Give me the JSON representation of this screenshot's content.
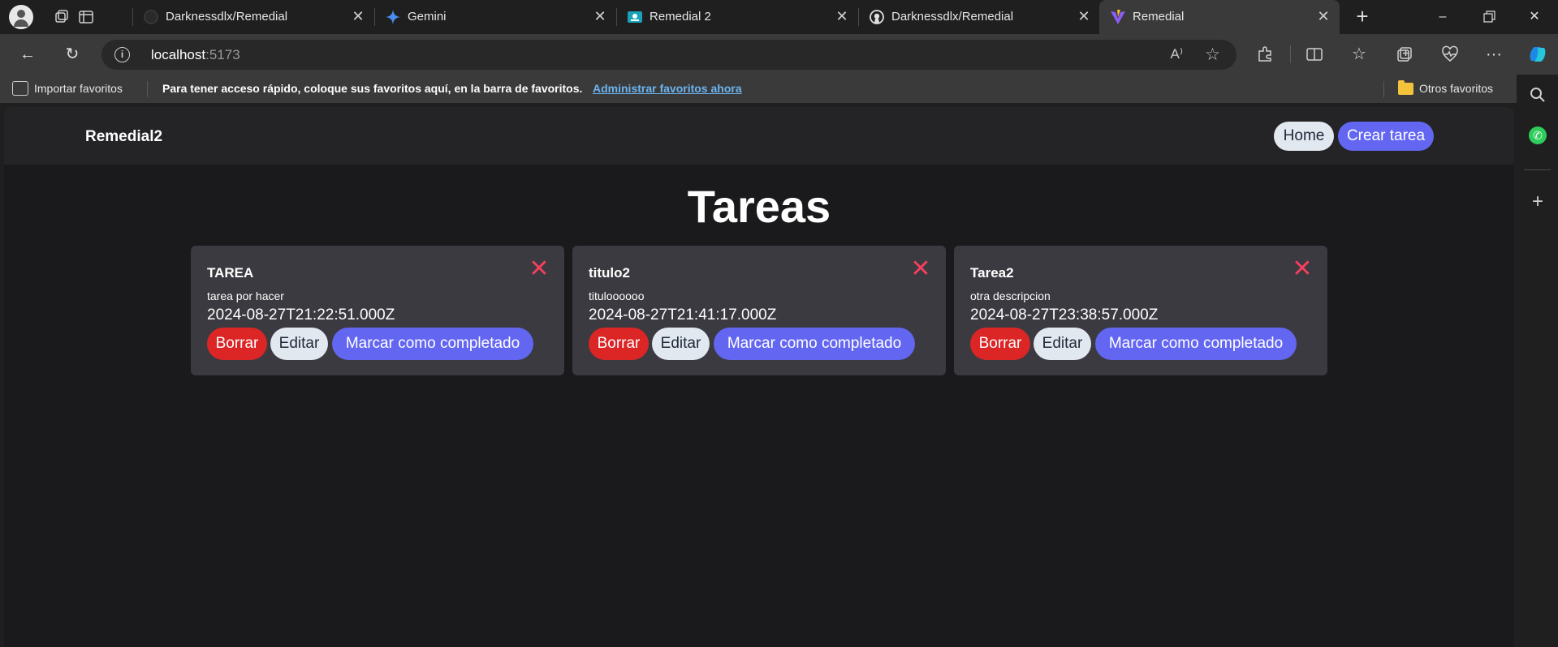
{
  "browser": {
    "tabs": [
      {
        "title": "Darknessdlx/Remedial",
        "icon": "github-icon",
        "active": false
      },
      {
        "title": "Gemini",
        "icon": "gemini-icon",
        "active": false
      },
      {
        "title": "Remedial 2",
        "icon": "classroom-icon",
        "active": false
      },
      {
        "title": "Darknessdlx/Remedial",
        "icon": "github-icon",
        "active": false
      },
      {
        "title": "Remedial",
        "icon": "vite-icon",
        "active": true
      }
    ],
    "tab_close_glyph": "✕",
    "new_tab_glyph": "+",
    "address": {
      "host": "localhost",
      "port": ":5173"
    },
    "favorites_bar": {
      "import_label": "Importar favoritos",
      "message": "Para tener acceso rápido, coloque sus favoritos aquí, en la barra de favoritos.",
      "manage_link": "Administrar favoritos ahora",
      "other_favorites": "Otros favoritos"
    }
  },
  "app": {
    "brand": "Remedial2",
    "nav": {
      "home": "Home",
      "create": "Crear tarea"
    },
    "page_title": "Tareas",
    "tasks": [
      {
        "title": "TAREA",
        "description": "tarea por hacer",
        "date": "2024-08-27T21:22:51.000Z"
      },
      {
        "title": "titulo2",
        "description": "tituloooooo",
        "date": "2024-08-27T21:41:17.000Z"
      },
      {
        "title": "Tarea2",
        "description": "otra descripcion",
        "date": "2024-08-27T23:38:57.000Z"
      }
    ],
    "task_actions": {
      "delete": "Borrar",
      "edit": "Editar",
      "complete": "Marcar como completado"
    },
    "delete_glyph": "✕"
  },
  "colors": {
    "accent": "#6366f1",
    "danger": "#dc2626",
    "close_x": "#f43f5e",
    "light_button": "#e2e8f0",
    "card_bg": "#3a3a40"
  }
}
